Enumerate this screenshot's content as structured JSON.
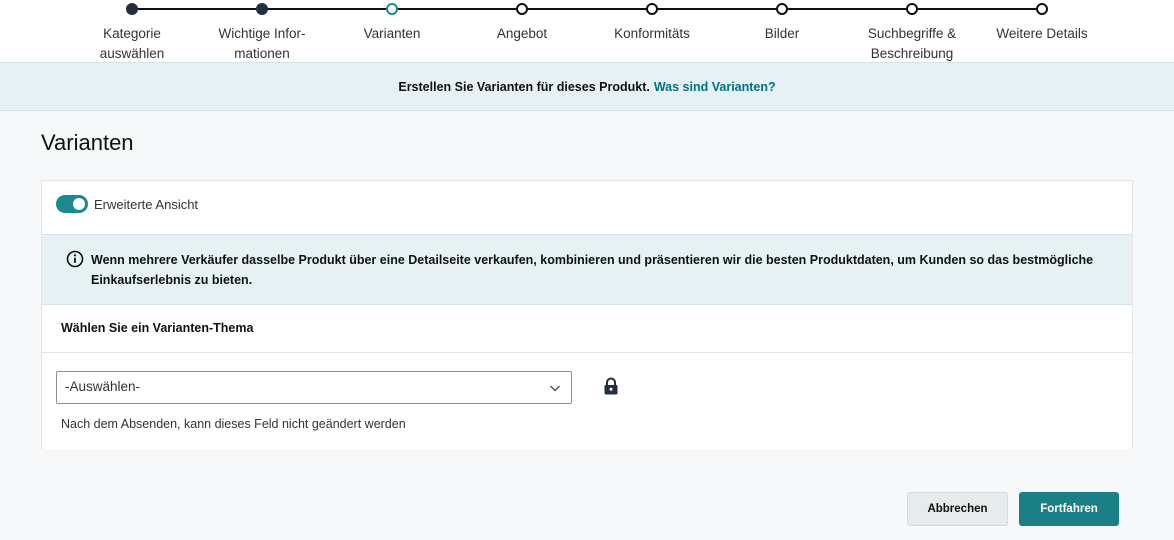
{
  "stepper": {
    "steps": [
      {
        "label": "Kategorie\nauswählen",
        "state": "done"
      },
      {
        "label": "Wichtige Infor-\nmationen",
        "state": "done"
      },
      {
        "label": "Varianten",
        "state": "current"
      },
      {
        "label": "Angebot",
        "state": "todo"
      },
      {
        "label": "Konformitäts",
        "state": "todo"
      },
      {
        "label": "Bilder",
        "state": "todo"
      },
      {
        "label": "Suchbegriffe &\nBeschreibung",
        "state": "todo"
      },
      {
        "label": "Weitere Details",
        "state": "todo"
      }
    ]
  },
  "banner": {
    "text": "Erstellen Sie Varianten für dieses Produkt.",
    "link": "Was sind Varianten?"
  },
  "page": {
    "title": "Varianten"
  },
  "card": {
    "toggle_label": "Erweiterte Ansicht",
    "toggle_on": true,
    "info_text": "Wenn mehrere Verkäufer dasselbe Produkt über eine Detailseite verkaufen, kombinieren und präsentieren wir die besten Produktdaten, um Kunden so das bestmögliche Einkaufserlebnis zu bieten.",
    "theme_heading": "Wählen Sie ein Varianten-Thema",
    "select_value": "-Auswählen-",
    "helper_text": "Nach dem Absenden, kann dieses Feld nicht geändert werden"
  },
  "actions": {
    "cancel_label": "Abbrechen",
    "continue_label": "Fortfahren"
  },
  "colors": {
    "accent": "#1b8a8f",
    "link": "#007185",
    "banner_bg": "#e6f1f3",
    "primary_button": "#1b7f86"
  }
}
